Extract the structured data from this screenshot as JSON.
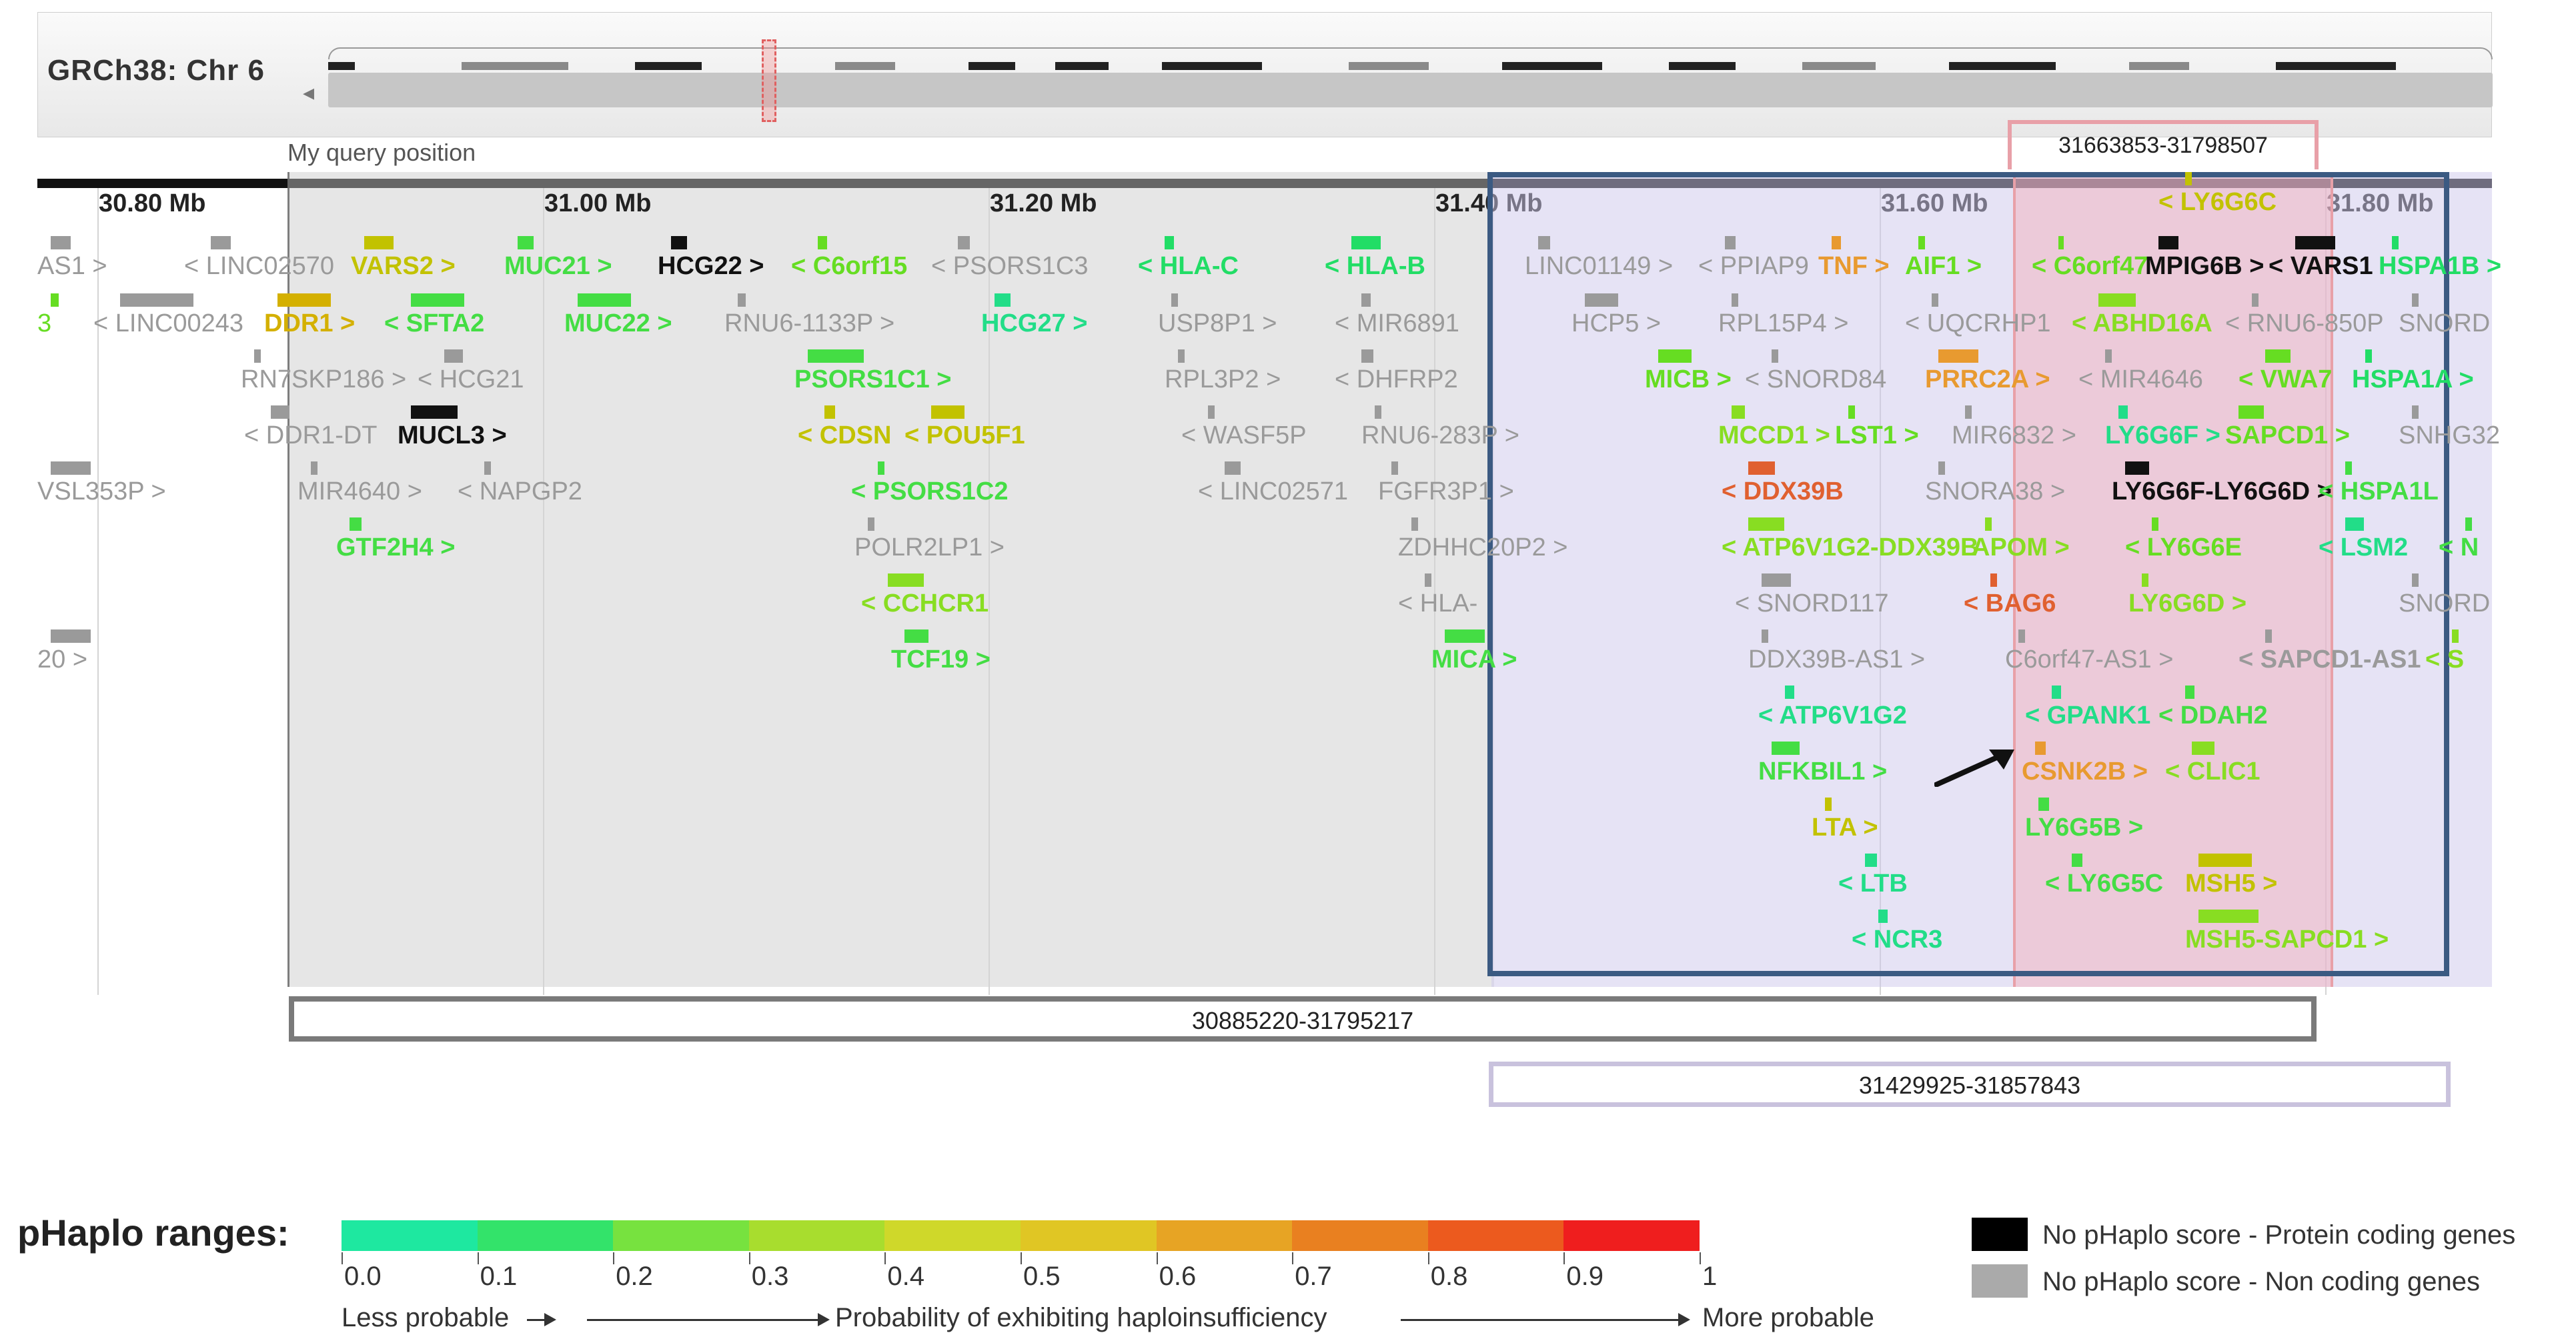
{
  "header": {
    "title": "GRCh38: Chr 6"
  },
  "query_label": "My query position",
  "pink_region_label": "31663853-31798507",
  "region_boxes": {
    "box1": "30885220-31795217",
    "box2": "31429925-31857843"
  },
  "ruler": [
    "30.80 Mb",
    "31.00 Mb",
    "31.20 Mb",
    "31.40 Mb",
    "31.60 Mb",
    "31.80 Mb"
  ],
  "genes": [
    {
      "label": "AS1 >",
      "c": "#9a9a9a"
    },
    {
      "label": "< LINC02570",
      "c": "#9a9a9a"
    },
    {
      "label": "VARS2 >",
      "c": "#c2c200"
    },
    {
      "label": "MUC21 >",
      "c": "#44dd44"
    },
    {
      "label": "HCG22 >",
      "c": "#111111"
    },
    {
      "label": "< C6orf15",
      "c": "#66dd22"
    },
    {
      "label": "< PSORS1C3",
      "c": "#9a9a9a"
    },
    {
      "label": "< HLA-C",
      "c": "#22dd66"
    },
    {
      "label": "< HLA-B",
      "c": "#22dd66"
    },
    {
      "label": "LINC01149 >",
      "c": "#9a9a9a"
    },
    {
      "label": "< PPIAP9",
      "c": "#9a9a9a"
    },
    {
      "label": "TNF >",
      "c": "#e89a30"
    },
    {
      "label": "AIF1 >",
      "c": "#66dd22"
    },
    {
      "label": "< C6orf47",
      "c": "#66dd22"
    },
    {
      "label": "MPIG6B >",
      "c": "#111111"
    },
    {
      "label": "< VARS1",
      "c": "#111111"
    },
    {
      "label": "HSPA1B >",
      "c": "#22dd66"
    },
    {
      "label": "3",
      "c": "#66dd22"
    },
    {
      "label": "< LINC00243",
      "c": "#9a9a9a"
    },
    {
      "label": "DDR1 >",
      "c": "#d4b000"
    },
    {
      "label": "< SFTA2",
      "c": "#44dd44"
    },
    {
      "label": "MUC22 >",
      "c": "#44dd44"
    },
    {
      "label": "RNU6-1133P >",
      "c": "#9a9a9a"
    },
    {
      "label": "HCG27 >",
      "c": "#22dd88"
    },
    {
      "label": "USP8P1 >",
      "c": "#9a9a9a"
    },
    {
      "label": "< MIR6891",
      "c": "#9a9a9a"
    },
    {
      "label": "HCP5 >",
      "c": "#9a9a9a"
    },
    {
      "label": "RPL15P4 >",
      "c": "#9a9a9a"
    },
    {
      "label": "< UQCRHP1",
      "c": "#9a9a9a"
    },
    {
      "label": "< ABHD16A",
      "c": "#88dd22"
    },
    {
      "label": "< RNU6-850P",
      "c": "#9a9a9a"
    },
    {
      "label": "SNORD",
      "c": "#9a9a9a"
    },
    {
      "label": "RN7SKP186 >",
      "c": "#9a9a9a"
    },
    {
      "label": "< HCG21",
      "c": "#9a9a9a"
    },
    {
      "label": "PSORS1C1 >",
      "c": "#44dd44"
    },
    {
      "label": "RPL3P2 >",
      "c": "#9a9a9a"
    },
    {
      "label": "< DHFRP2",
      "c": "#9a9a9a"
    },
    {
      "label": "MICB >",
      "c": "#66dd22"
    },
    {
      "label": "< SNORD84",
      "c": "#9a9a9a"
    },
    {
      "label": "PRRC2A >",
      "c": "#e89a30"
    },
    {
      "label": "< MIR4646",
      "c": "#9a9a9a"
    },
    {
      "label": "< VWA7",
      "c": "#66dd22"
    },
    {
      "label": "HSPA1A >",
      "c": "#22dd66"
    },
    {
      "label": "< DDR1-DT",
      "c": "#9a9a9a"
    },
    {
      "label": "MUCL3 >",
      "c": "#111111"
    },
    {
      "label": "< CDSN",
      "c": "#c2c200"
    },
    {
      "label": "< POU5F1",
      "c": "#c2c200"
    },
    {
      "label": "< WASF5P",
      "c": "#9a9a9a"
    },
    {
      "label": "RNU6-283P >",
      "c": "#9a9a9a"
    },
    {
      "label": "MCCD1 >",
      "c": "#88dd22"
    },
    {
      "label": "LST1 >",
      "c": "#66dd22"
    },
    {
      "label": "MIR6832 >",
      "c": "#9a9a9a"
    },
    {
      "label": "LY6G6F >",
      "c": "#22dd88"
    },
    {
      "label": "SAPCD1 >",
      "c": "#66dd22"
    },
    {
      "label": "SNHG32",
      "c": "#9a9a9a"
    },
    {
      "label": "VSL353P >",
      "c": "#9a9a9a"
    },
    {
      "label": "MIR4640 >",
      "c": "#9a9a9a"
    },
    {
      "label": "< NAPGP2",
      "c": "#9a9a9a"
    },
    {
      "label": "< PSORS1C2",
      "c": "#44dd44"
    },
    {
      "label": "< LINC02571",
      "c": "#9a9a9a"
    },
    {
      "label": "FGFR3P1 >",
      "c": "#9a9a9a"
    },
    {
      "label": "< DDX39B",
      "c": "#e06030"
    },
    {
      "label": "SNORA38 >",
      "c": "#9a9a9a"
    },
    {
      "label": "LY6G6F-LY6G6D >",
      "c": "#111111"
    },
    {
      "label": "< HSPA1L",
      "c": "#44dd44"
    },
    {
      "label": "GTF2H4 >",
      "c": "#44dd44"
    },
    {
      "label": "POLR2LP1 >",
      "c": "#9a9a9a"
    },
    {
      "label": "ZDHHC20P2 >",
      "c": "#9a9a9a"
    },
    {
      "label": "< ATP6V1G2-DDX39B",
      "c": "#88dd22"
    },
    {
      "label": "APOM >",
      "c": "#88dd22"
    },
    {
      "label": "< LY6G6E",
      "c": "#66dd22"
    },
    {
      "label": "< LSM2",
      "c": "#22dd88"
    },
    {
      "label": "< N",
      "c": "#44dd44"
    },
    {
      "label": "< CCHCR1",
      "c": "#88dd22"
    },
    {
      "label": "< HLA-",
      "c": "#9a9a9a"
    },
    {
      "label": "< SNORD117",
      "c": "#9a9a9a"
    },
    {
      "label": "< BAG6",
      "c": "#e06030"
    },
    {
      "label": "LY6G6D >",
      "c": "#88dd22"
    },
    {
      "label": "SNORD",
      "c": "#9a9a9a"
    },
    {
      "label": "20 >",
      "c": "#9a9a9a"
    },
    {
      "label": "TCF19 >",
      "c": "#44dd44"
    },
    {
      "label": "MICA >",
      "c": "#44dd44"
    },
    {
      "label": "DDX39B-AS1 >",
      "c": "#9a9a9a"
    },
    {
      "label": "C6orf47-AS1 >",
      "c": "#9a9a9a"
    },
    {
      "label": "< SAPCD1-AS1",
      "c": "#9a9a9a"
    },
    {
      "label": "< S",
      "c": "#88dd22"
    },
    {
      "label": "< ATP6V1G2",
      "c": "#22dd88"
    },
    {
      "label": "< GPANK1",
      "c": "#22dd88"
    },
    {
      "label": "< DDAH2",
      "c": "#44dd44"
    },
    {
      "label": "NFKBIL1 >",
      "c": "#44dd44"
    },
    {
      "label": "CSNK2B >",
      "c": "#e89a30"
    },
    {
      "label": "< CLIC1",
      "c": "#88dd22"
    },
    {
      "label": "LTA >",
      "c": "#c2c200"
    },
    {
      "label": "LY6G5B >",
      "c": "#44dd44"
    },
    {
      "label": "MSH5 >",
      "c": "#c2c200"
    },
    {
      "label": "< LTB",
      "c": "#22dd88"
    },
    {
      "label": "< LY6G5C",
      "c": "#44dd44"
    },
    {
      "label": "MSH5-SAPCD1 >",
      "c": "#88dd22"
    },
    {
      "label": "< NCR3",
      "c": "#22dd88"
    },
    {
      "label": "< LY6G6C",
      "c": "#c2c200"
    }
  ],
  "legend": {
    "title": "pHaplo ranges:",
    "colors": [
      "#1ee8a0",
      "#33e36a",
      "#77e23f",
      "#a8dd2e",
      "#cfd82a",
      "#e0c624",
      "#e7a424",
      "#e98020",
      "#ec5a1e",
      "#ef1e1e"
    ],
    "ticks": [
      "0.0",
      "0.1",
      "0.2",
      "0.3",
      "0.4",
      "0.5",
      "0.6",
      "0.7",
      "0.8",
      "0.9",
      "1"
    ],
    "less": "Less probable",
    "probability": "Probability of exhibiting haploinsufficiency",
    "more": "More probable",
    "protein_coding": "No pHaplo score - Protein coding genes",
    "non_coding": "No pHaplo score - Non coding genes"
  }
}
